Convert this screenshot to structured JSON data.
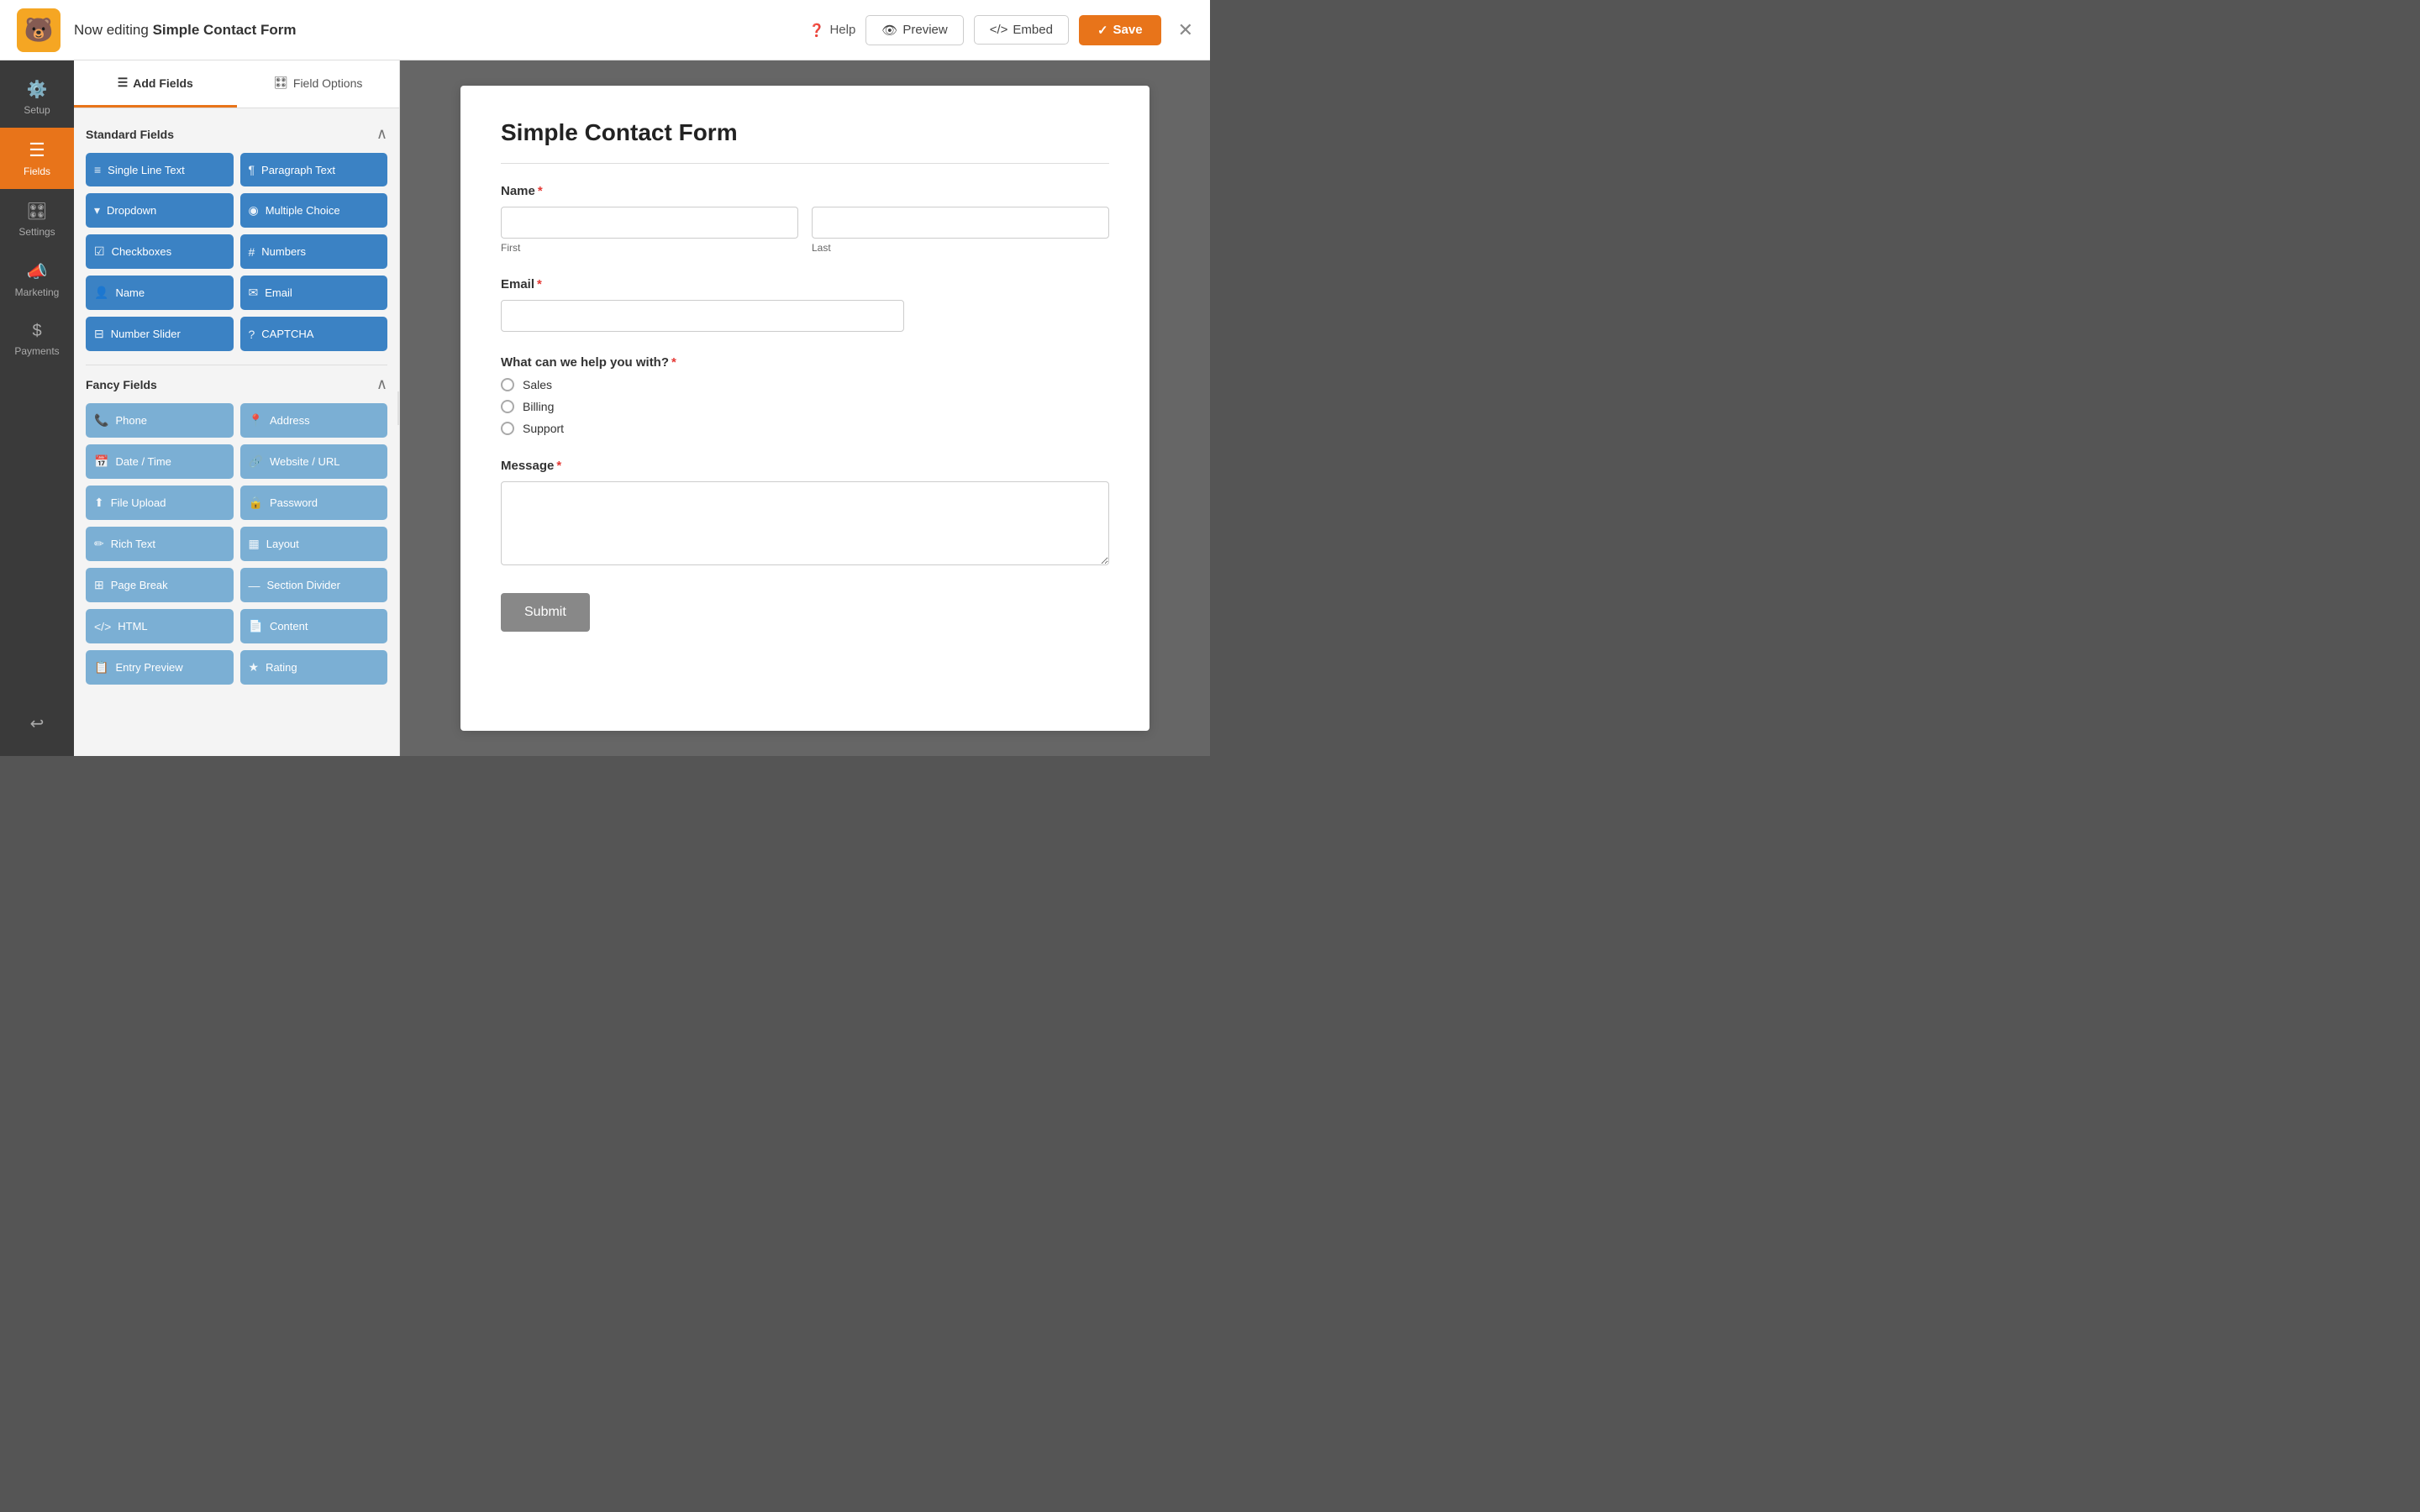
{
  "topbar": {
    "logo_emoji": "🐻",
    "editing_prefix": "Now editing ",
    "form_name": "Simple Contact Form",
    "help_label": "Help",
    "preview_label": "Preview",
    "embed_label": "Embed",
    "save_label": "Save"
  },
  "sidenav": {
    "items": [
      {
        "id": "setup",
        "label": "Setup",
        "icon": "⚙️"
      },
      {
        "id": "fields",
        "label": "Fields",
        "icon": "☰",
        "active": true
      },
      {
        "id": "settings",
        "label": "Settings",
        "icon": "🎛️"
      },
      {
        "id": "marketing",
        "label": "Marketing",
        "icon": "📣"
      },
      {
        "id": "payments",
        "label": "Payments",
        "icon": "💲"
      }
    ],
    "bottom": {
      "icon": "↩️"
    }
  },
  "panel": {
    "tab_add_fields": "Add Fields",
    "tab_field_options": "Field Options",
    "standard_fields_title": "Standard Fields",
    "fancy_fields_title": "Fancy Fields",
    "standard_fields": [
      {
        "label": "Single Line Text",
        "icon": "T"
      },
      {
        "label": "Paragraph Text",
        "icon": "¶"
      },
      {
        "label": "Dropdown",
        "icon": "▾"
      },
      {
        "label": "Multiple Choice",
        "icon": "◉"
      },
      {
        "label": "Checkboxes",
        "icon": "☑"
      },
      {
        "label": "Numbers",
        "icon": "#"
      },
      {
        "label": "Name",
        "icon": "👤"
      },
      {
        "label": "Email",
        "icon": "✉"
      },
      {
        "label": "Number Slider",
        "icon": "⊟"
      },
      {
        "label": "CAPTCHA",
        "icon": "?"
      }
    ],
    "fancy_fields": [
      {
        "label": "Phone",
        "icon": "📞"
      },
      {
        "label": "Address",
        "icon": "📍"
      },
      {
        "label": "Date / Time",
        "icon": "📅"
      },
      {
        "label": "Website / URL",
        "icon": "🔗"
      },
      {
        "label": "File Upload",
        "icon": "⬆"
      },
      {
        "label": "Password",
        "icon": "🔒"
      },
      {
        "label": "Rich Text",
        "icon": "✏"
      },
      {
        "label": "Layout",
        "icon": "▦"
      },
      {
        "label": "Page Break",
        "icon": "⊞"
      },
      {
        "label": "Section Divider",
        "icon": "—"
      },
      {
        "label": "HTML",
        "icon": "<>"
      },
      {
        "label": "Content",
        "icon": "📄"
      },
      {
        "label": "Entry Preview",
        "icon": "📋"
      },
      {
        "label": "Rating",
        "icon": "★"
      }
    ]
  },
  "form": {
    "title": "Simple Contact Form",
    "fields": [
      {
        "type": "name",
        "label": "Name",
        "required": true,
        "subfields": [
          "First",
          "Last"
        ]
      },
      {
        "type": "email",
        "label": "Email",
        "required": true
      },
      {
        "type": "radio",
        "label": "What can we help you with?",
        "required": true,
        "options": [
          "Sales",
          "Billing",
          "Support"
        ]
      },
      {
        "type": "textarea",
        "label": "Message",
        "required": true
      }
    ],
    "submit_label": "Submit"
  }
}
